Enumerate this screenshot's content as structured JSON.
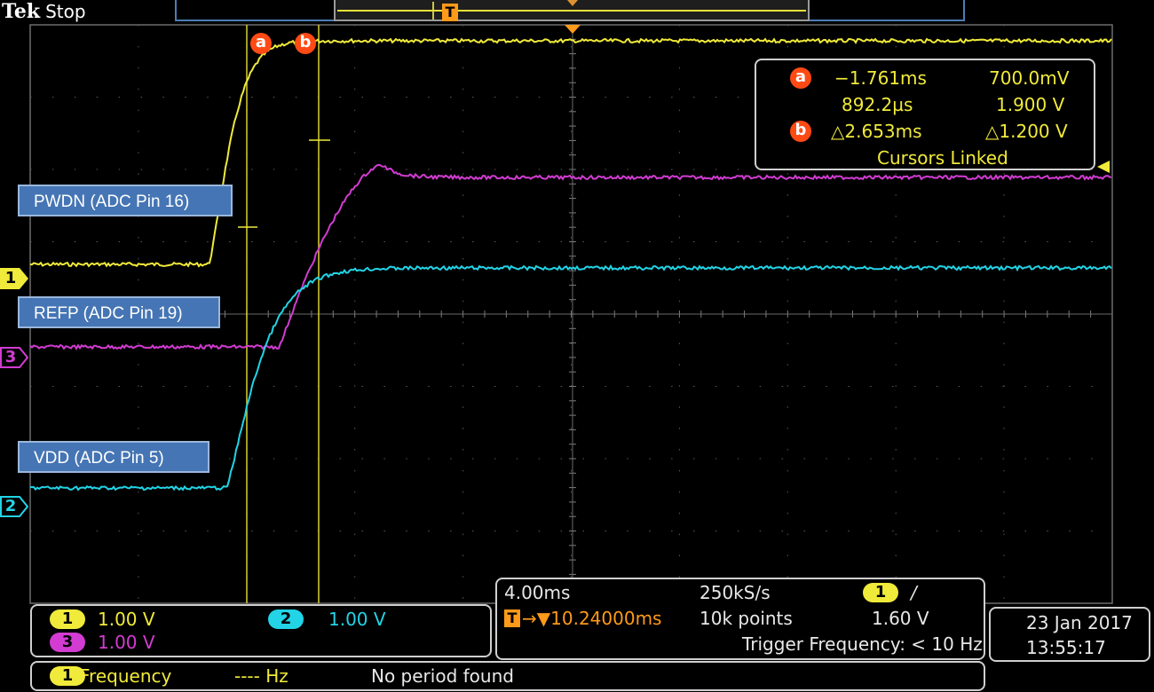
{
  "header": {
    "brand": "Tek",
    "acquisition_state": "Stop",
    "trigger_marker_glyph": "T"
  },
  "colors": {
    "ch1": "#f0ea3a",
    "ch2": "#22d4e6",
    "ch3": "#d23cd2",
    "cursor_badge": "#ff4a14",
    "trigger": "#ff9a1a",
    "label_box": "#4575b4"
  },
  "channel_markers": [
    {
      "id": "1",
      "color": "#f0ea3a"
    },
    {
      "id": "3",
      "color": "#d23cd2"
    },
    {
      "id": "2",
      "color": "#22d4e6"
    }
  ],
  "signal_labels": {
    "pwdn": "PWDN (ADC Pin 16)",
    "refp": "REFP (ADC Pin 19)",
    "vdd": "VDD (ADC Pin 5)"
  },
  "cursors": {
    "a_badge": "a",
    "b_badge": "b",
    "a_time": "−1.761ms",
    "a_volt": "700.0mV",
    "b_time": "892.2µs",
    "b_volt": "1.900 V",
    "delta_time": "△2.653ms",
    "delta_volt": "△1.200 V",
    "status": "Cursors Linked"
  },
  "channels_panel": {
    "ch1_id": "1",
    "ch1_scale": "1.00 V",
    "ch2_id": "2",
    "ch2_scale": "1.00 V",
    "ch3_id": "3",
    "ch3_scale": "1.00 V"
  },
  "horizontal_panel": {
    "time_per_div": "4.00ms",
    "sample_rate": "250kS/s",
    "trigger_source": "1",
    "trigger_slope_glyph": "/",
    "trigger_position": "→▼10.24000ms",
    "trigger_t": "T",
    "record_length": "10k points",
    "trigger_level": "1.60 V",
    "trigger_frequency": "Trigger Frequency: < 10 Hz"
  },
  "datetime": {
    "date": "23 Jan  2017",
    "time": "13:55:17"
  },
  "measurement": {
    "source": "1",
    "name": "Frequency",
    "value": "----  Hz",
    "status": "No period found"
  }
}
